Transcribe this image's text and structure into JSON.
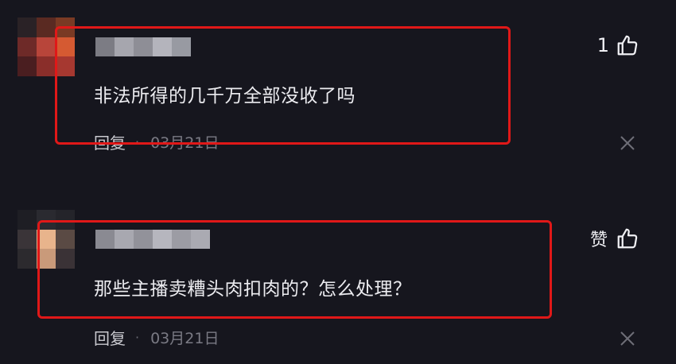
{
  "colors": {
    "background": "#16161e",
    "annotation_red": "#e01818",
    "text": "#ececf0",
    "muted": "#7a7a84"
  },
  "comments": [
    {
      "text": "非法所得的几千万全部没收了吗",
      "reply_label": "回复",
      "separator": "·",
      "date": "03月21日",
      "like_count": "1",
      "like_icon": "thumbs-up-icon",
      "close_icon": "close-icon"
    },
    {
      "text": "那些主播卖糟头肉扣肉的？怎么处理？",
      "reply_label": "回复",
      "separator": "·",
      "date": "03月21日",
      "like_label": "赞",
      "like_icon": "thumbs-up-icon",
      "close_icon": "close-icon"
    }
  ]
}
